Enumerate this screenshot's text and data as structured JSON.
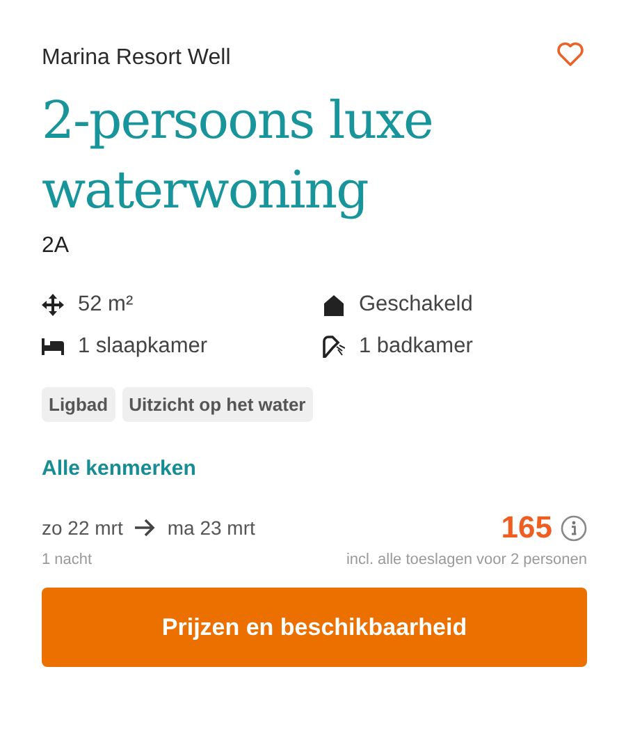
{
  "resort": "Marina Resort Well",
  "favorited": false,
  "title": "2-persoons luxe waterwoning",
  "code": "2A",
  "features": [
    {
      "kind": "area",
      "label": "52 m²"
    },
    {
      "kind": "house",
      "label": "Geschakeld"
    },
    {
      "kind": "bed",
      "label": "1 slaapkamer"
    },
    {
      "kind": "shower",
      "label": "1 badkamer"
    }
  ],
  "tags": [
    "Ligbad",
    "Uitzicht op het water"
  ],
  "link": "Alle kenmerken",
  "dates": {
    "from": "zo 22 mrt",
    "to": "ma 23 mrt",
    "nights": "1 nacht"
  },
  "price": {
    "amount": "165",
    "note": "incl. alle toeslagen voor 2 personen"
  },
  "button": "Prijzen en beschikbaarheid"
}
